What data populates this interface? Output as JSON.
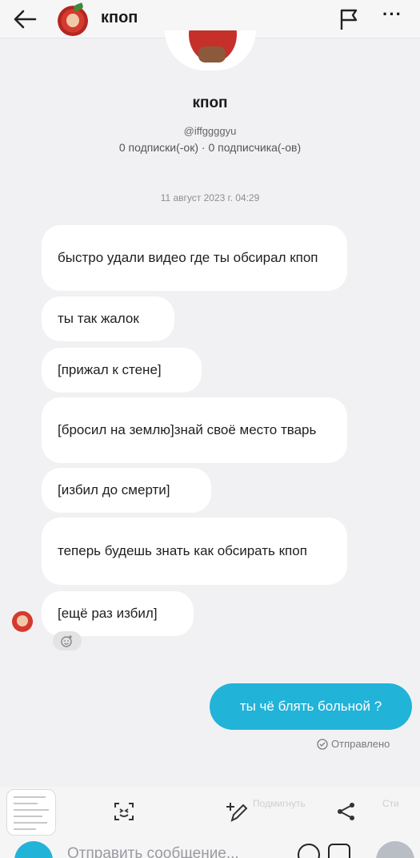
{
  "header": {
    "title": "кпоп",
    "more_label": "···"
  },
  "profile": {
    "name": "кпоп",
    "handle": "@iffggggyu",
    "stats": "0 подписки(-ок) · 0 подписчика(-ов)"
  },
  "chat": {
    "timestamp": "11 август 2023 г. 04:29",
    "incoming": [
      "быстро удали видео где ты обсирал кпоп",
      "ты так жалок",
      "[прижал к стене]",
      "[бросил на землю]знай своё место тварь",
      "[избил до смерти]",
      "теперь будешь знать как обсирать кпоп",
      "[ещё раз избил]"
    ],
    "outgoing": "ты чё блять больной ?",
    "status": "Отправлено"
  },
  "toolbar": {
    "wink_label": "Подмигнуть",
    "sticker_label": "Сти"
  },
  "composer": {
    "placeholder": "Отправить сообщение..."
  },
  "colors": {
    "accent": "#22b3d8",
    "background": "#f1f1f3",
    "bubble": "#ffffff"
  },
  "icons": [
    "back-arrow-icon",
    "flag-icon",
    "more-icon",
    "add-reaction-icon",
    "sent-icon",
    "camera-icon",
    "emoji-icon",
    "sticker-icon",
    "send-icon",
    "share-icon",
    "edit-icon",
    "smile-icon"
  ]
}
